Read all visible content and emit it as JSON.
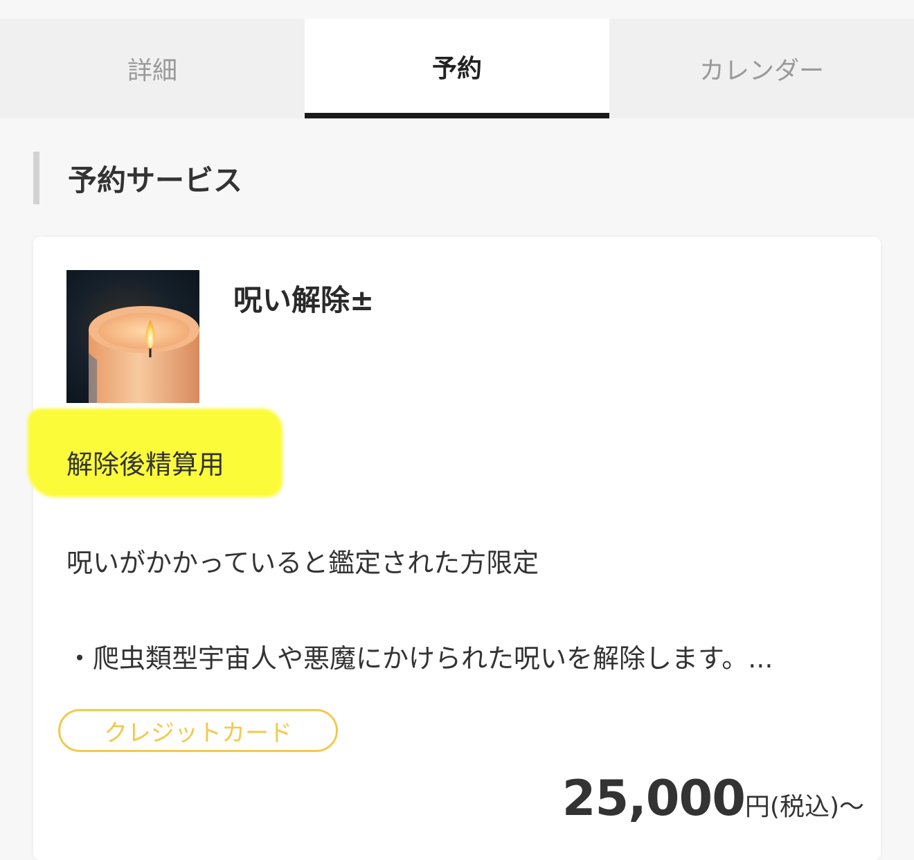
{
  "tabs": [
    {
      "label": "詳細",
      "active": false
    },
    {
      "label": "予約",
      "active": true
    },
    {
      "label": "カレンダー",
      "active": false
    }
  ],
  "section": {
    "title": "予約サービス"
  },
  "service": {
    "name": "呪い解除±",
    "image": "candle-photo",
    "subtitle": "解除後精算用",
    "highlight_color": "#fbfb3a",
    "description_line1": "呪いがかかっていると鑑定された方限定",
    "description_line2": "・爬虫類型宇宙人や悪魔にかけられた呪いを解除します。...",
    "payment_badge": "クレジットカード",
    "badge_color": "#f2c94c",
    "price_amount": "25,000",
    "price_unit": "円(税込)〜"
  }
}
